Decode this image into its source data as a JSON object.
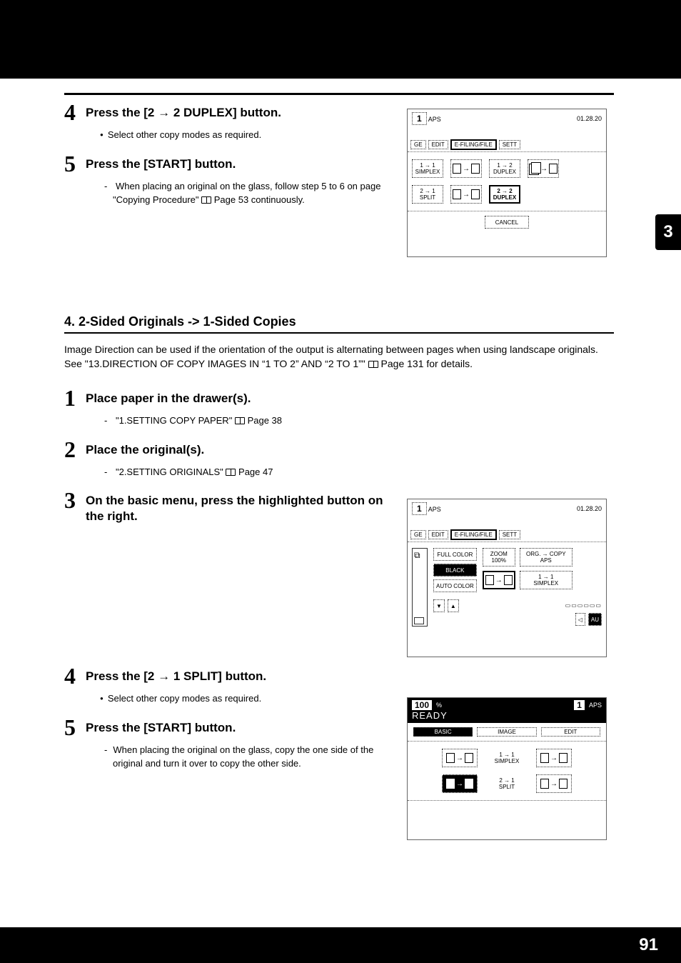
{
  "thumb_tab": "3",
  "page_num": "91",
  "s1": {
    "step4": {
      "num": "4",
      "title_a": "Press the [2 ",
      "arrow": "→",
      "title_b": " 2 DUPLEX] button.",
      "bullet": "Select other copy modes as required."
    },
    "step5": {
      "num": "5",
      "title": "Press the [START] button.",
      "dash": "When placing an original on the glass, follow step 5 to 6 on page \"Copying Procedure\" ",
      "dash_tail": " Page 53 continuously."
    }
  },
  "fig1": {
    "aps_num": "1",
    "aps": "APS",
    "clock": "01.28.20",
    "tabs": {
      "ge": "GE",
      "edit": "EDIT",
      "efile": "E-FILING/FILE",
      "sett": "SETT"
    },
    "opts": {
      "simplex_lbl": "1 → 1\nSIMPLEX",
      "duplex12_lbl": "1 → 2\nDUPLEX",
      "split_lbl": "2 → 1\nSPLIT",
      "duplex22_lbl": "2 → 2\nDUPLEX"
    },
    "cancel": "CANCEL"
  },
  "section": {
    "title": "4. 2-Sided Originals -> 1-Sided Copies",
    "para_a": "Image Direction can be used if the orientation of the output is alternating between pages when using landscape originals. See \"13.DIRECTION OF COPY IMAGES IN “1 TO 2” AND “2 TO 1”\" ",
    "para_b": " Page 131 for details."
  },
  "s2": {
    "step1": {
      "num": "1",
      "title": "Place paper in the drawer(s).",
      "dash": "\"1.SETTING COPY PAPER\" ",
      "dash_tail": " Page 38"
    },
    "step2": {
      "num": "2",
      "title": "Place the original(s).",
      "dash": "\"2.SETTING ORIGINALS\" ",
      "dash_tail": " Page 47"
    },
    "step3": {
      "num": "3",
      "title": "On the basic menu, press the highlighted button on the right."
    },
    "step4": {
      "num": "4",
      "title_a": "Press the [2 ",
      "arrow": "→",
      "title_b": " 1 SPLIT] button.",
      "bullet": "Select other copy modes as required."
    },
    "step5": {
      "num": "5",
      "title": "Press the [START] button.",
      "dash": "When placing the original on the glass, copy the one side of the original and turn it over to copy the other side."
    }
  },
  "fig2": {
    "aps_num": "1",
    "aps": "APS",
    "clock": "01.28.20",
    "tabs": {
      "ge": "GE",
      "edit": "EDIT",
      "efile": "E-FILING/FILE",
      "sett": "SETT"
    },
    "color": {
      "full": "FULL COLOR",
      "black": "BLACK",
      "auto": "AUTO COLOR"
    },
    "zoom": "ZOOM\n100%",
    "org": "ORG. → COPY\nAPS",
    "simplex": "1 → 1\nSIMPLEX",
    "small": {
      "down": "▼",
      "up": "▲",
      "clear": "◁",
      "au": "AU"
    }
  },
  "fig3": {
    "pct": "100",
    "pct_sym": "%",
    "aps_num": "1",
    "aps": "APS",
    "ready": "READY",
    "tabs": {
      "basic": "BASIC",
      "image": "IMAGE",
      "edit": "EDIT"
    },
    "opts": {
      "simplex": "1 → 1\nSIMPLEX",
      "split": "2 → 1\nSPLIT"
    }
  }
}
